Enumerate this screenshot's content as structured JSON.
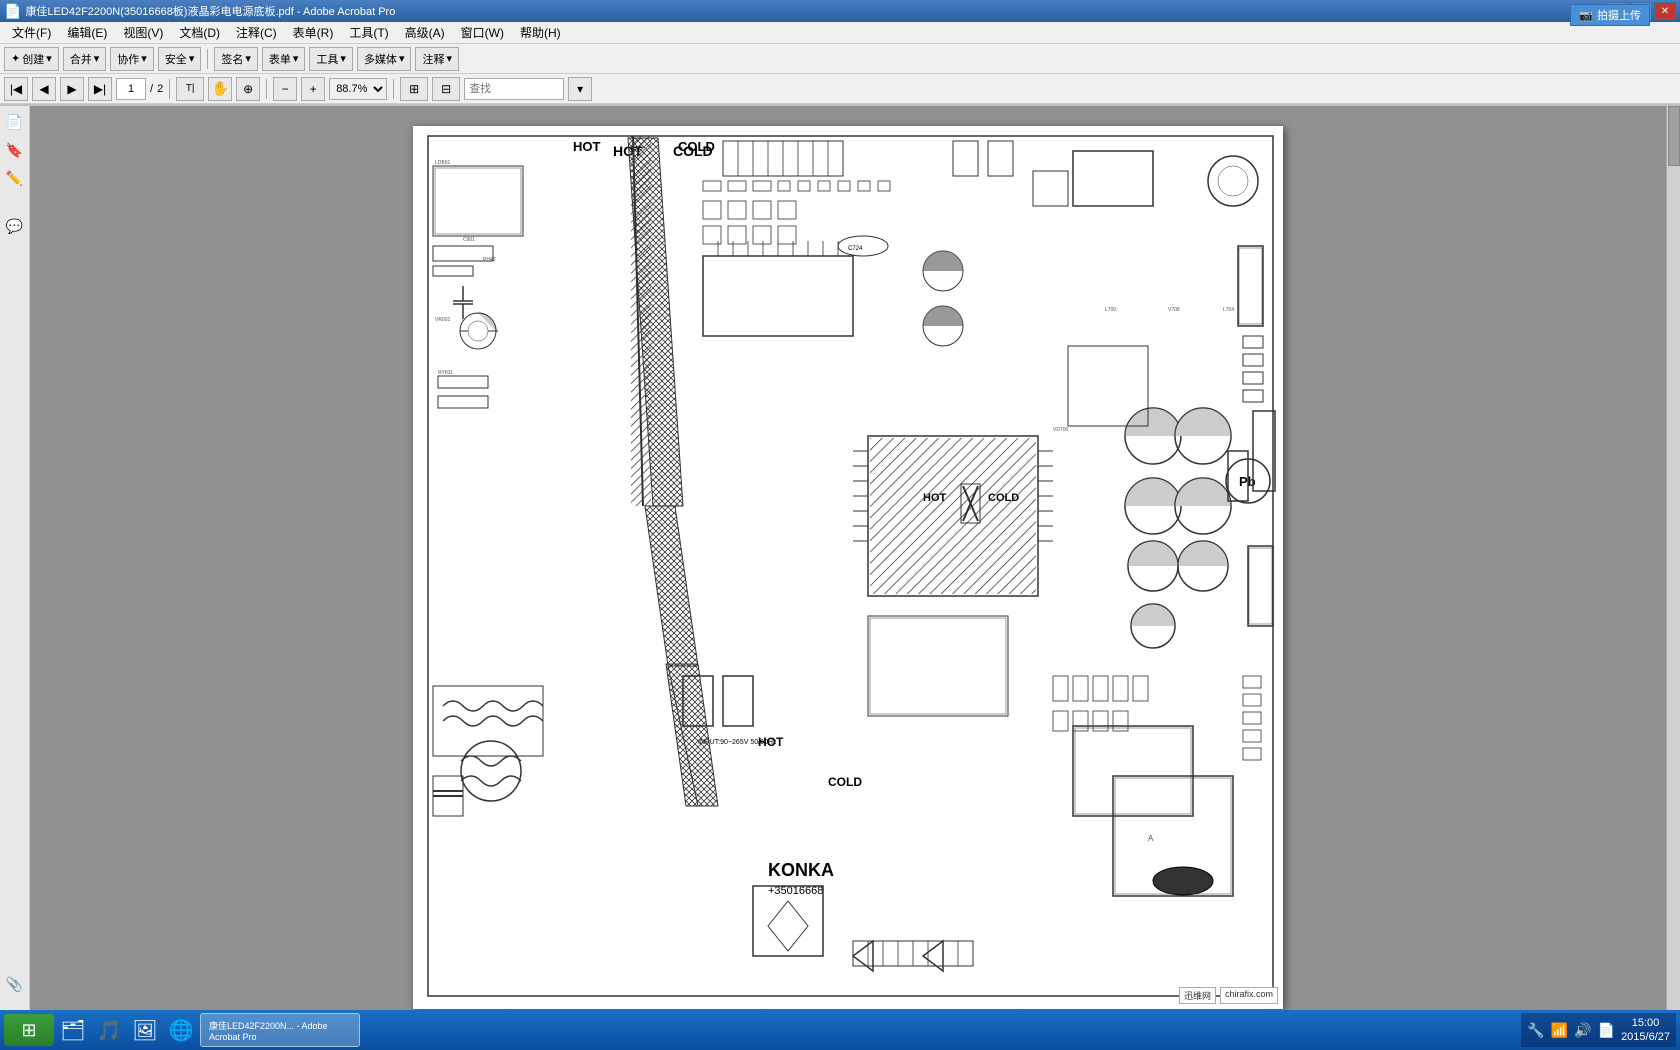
{
  "titlebar": {
    "title": "康佳LED42F2200N(35016668板)液晶彩电电源底板.pdf - Adobe Acrobat Pro",
    "minimize": "─",
    "maximize": "□",
    "close": "✕"
  },
  "upload_btn": "拍摄上传",
  "menubar": {
    "items": [
      "文件(F)",
      "编辑(E)",
      "视图(V)",
      "文档(D)",
      "注释(C)",
      "表单(R)",
      "工具(T)",
      "高级(A)",
      "窗口(W)",
      "帮助(H)"
    ]
  },
  "toolbar1": {
    "create": "创建",
    "merge": "合并",
    "collaborate": "协作",
    "security": "安全",
    "sign": "签名",
    "forms": "表单",
    "tools": "工具",
    "multimedia": "多媒体",
    "comment": "注释"
  },
  "toolbar2": {
    "page_current": "1",
    "page_total": "2",
    "zoom": "88.7%",
    "search_placeholder": "查找"
  },
  "schematic": {
    "hot_label_1": "HOT",
    "cold_label_1": "COLD",
    "hot_label_2": "HOT",
    "cold_label_2": "COLD",
    "hot_label_3": "HOT",
    "cold_label_3": "COLD",
    "brand": "KONKA",
    "model": "+35016668"
  },
  "taskbar": {
    "time": "15:00",
    "date": "2015/6/27",
    "logos": [
      "迅维网",
      "chirafix.com"
    ]
  },
  "sidebar_icons": [
    "📄",
    "📑",
    "✏️",
    "🔖",
    "💬"
  ]
}
